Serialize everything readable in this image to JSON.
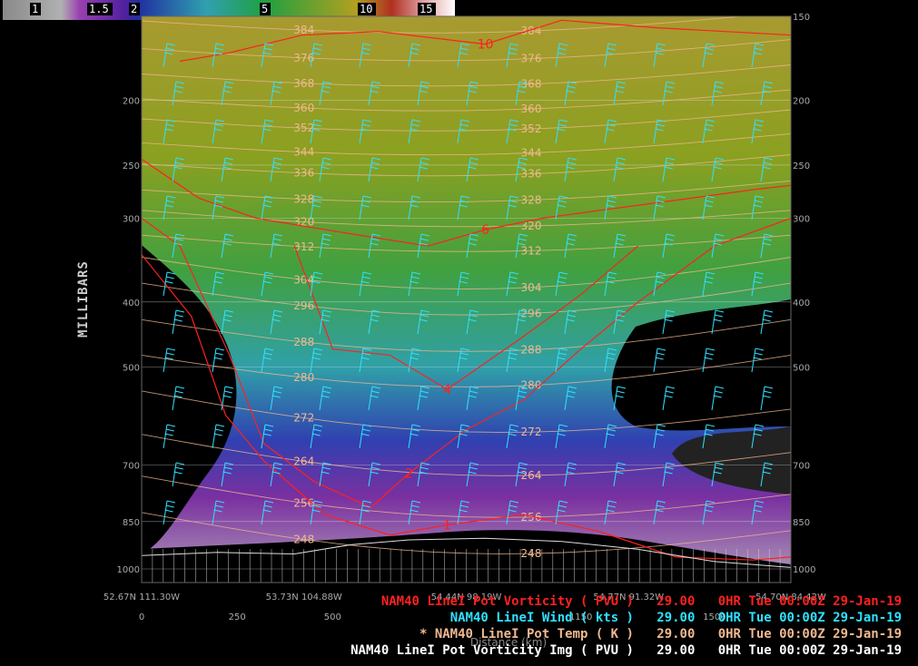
{
  "colorbar": {
    "ticks": [
      "1",
      "1.5",
      "2",
      "5",
      "10",
      "15"
    ]
  },
  "chart_data": {
    "type": "heatmap",
    "ylabel": "MILLIBARS",
    "xlabel": "Distance (km)",
    "yaxis": {
      "scale": "log",
      "ylim": [
        1000,
        150
      ],
      "left_ticks": [
        200,
        250,
        300,
        400,
        500,
        700,
        850,
        1000
      ],
      "right_ticks": [
        150,
        200,
        250,
        300,
        400,
        500,
        700,
        850,
        1000
      ]
    },
    "xaxis": {
      "xlim": [
        0,
        1700
      ],
      "distance_ticks": [
        0,
        250,
        500,
        1150,
        1500
      ],
      "location_labels": [
        {
          "d": 0,
          "text": "52.67N 111.30W"
        },
        {
          "d": 425,
          "text": "53.73N 104.88W"
        },
        {
          "d": 850,
          "text": "54.44N 98.19W"
        },
        {
          "d": 1275,
          "text": "54.77N 91.32W"
        },
        {
          "d": 1700,
          "text": "54.70N 84.42W"
        }
      ]
    },
    "pv_contours": [
      {
        "level": "10",
        "points": [
          [
            100,
            175
          ],
          [
            230,
            170
          ],
          [
            420,
            160
          ],
          [
            620,
            158
          ],
          [
            900,
            165
          ],
          [
            1100,
            152
          ],
          [
            1350,
            156
          ],
          [
            1700,
            160
          ]
        ]
      },
      {
        "level": "6",
        "points": [
          [
            0,
            245
          ],
          [
            150,
            280
          ],
          [
            300,
            300
          ],
          [
            450,
            310
          ],
          [
            600,
            320
          ],
          [
            750,
            330
          ],
          [
            900,
            312
          ],
          [
            1050,
            300
          ],
          [
            1200,
            292
          ],
          [
            1400,
            282
          ],
          [
            1600,
            272
          ],
          [
            1700,
            268
          ]
        ]
      },
      {
        "level": "4",
        "points": [
          [
            400,
            330
          ],
          [
            500,
            470
          ],
          [
            650,
            480
          ],
          [
            800,
            540
          ],
          [
            1000,
            450
          ],
          [
            1150,
            390
          ],
          [
            1300,
            330
          ]
        ]
      },
      {
        "level": "2",
        "points": [
          [
            0,
            300
          ],
          [
            100,
            330
          ],
          [
            230,
            480
          ],
          [
            320,
            650
          ],
          [
            450,
            740
          ],
          [
            600,
            810
          ],
          [
            700,
            720
          ],
          [
            850,
            620
          ],
          [
            1000,
            560
          ],
          [
            1150,
            470
          ],
          [
            1300,
            400
          ],
          [
            1500,
            330
          ],
          [
            1700,
            300
          ]
        ]
      },
      {
        "level": "1",
        "points": [
          [
            0,
            340
          ],
          [
            130,
            420
          ],
          [
            220,
            590
          ],
          [
            320,
            690
          ],
          [
            480,
            830
          ],
          [
            650,
            890
          ],
          [
            800,
            860
          ],
          [
            1000,
            830
          ],
          [
            1200,
            880
          ],
          [
            1400,
            960
          ],
          [
            1600,
            970
          ],
          [
            1700,
            960
          ]
        ]
      }
    ],
    "theta_contours": [
      {
        "label": "384",
        "p": 150
      },
      {
        "label": "376",
        "p": 165
      },
      {
        "label": "368",
        "p": 180
      },
      {
        "label": "360",
        "p": 196
      },
      {
        "label": "352",
        "p": 210
      },
      {
        "label": "344",
        "p": 228
      },
      {
        "label": "336",
        "p": 245
      },
      {
        "label": "328",
        "p": 268
      },
      {
        "label": "320",
        "p": 292
      },
      {
        "label": "312",
        "p": 318
      },
      {
        "label": "304",
        "p": 343
      },
      {
        "label": "296",
        "p": 375
      },
      {
        "label": "288",
        "p": 425
      },
      {
        "label": "280",
        "p": 480
      },
      {
        "label": "272",
        "p": 560
      },
      {
        "label": "264",
        "p": 650
      },
      {
        "label": "256",
        "p": 750
      },
      {
        "label": "248",
        "p": 850
      }
    ],
    "surface_pressure": [
      [
        0,
        955
      ],
      [
        200,
        945
      ],
      [
        400,
        950
      ],
      [
        550,
        920
      ],
      [
        700,
        905
      ],
      [
        900,
        900
      ],
      [
        1100,
        910
      ],
      [
        1300,
        935
      ],
      [
        1500,
        975
      ],
      [
        1700,
        995
      ]
    ]
  },
  "legend": [
    {
      "name": "NAM40 LineI Pot Vorticity ( PVU )",
      "value": "29.00",
      "time": "0HR Tue 00:00Z 29-Jan-19",
      "color": "#ff2020"
    },
    {
      "name": "NAM40 LineI Wind ( kts )",
      "value": "29.00",
      "time": "0HR Tue 00:00Z 29-Jan-19",
      "color": "#30e0ff"
    },
    {
      "name": "* NAM40 LineI Pot Temp ( K )",
      "value": "29.00",
      "time": "0HR Tue 00:00Z 29-Jan-19",
      "color": "#f0b890"
    },
    {
      "name": "NAM40 LineI Pot Vorticity Img ( PVU )",
      "value": "29.00",
      "time": "0HR Tue 00:00Z 29-Jan-19",
      "color": "#ffffff"
    }
  ],
  "colors": {
    "pv_contour": "#ff2020",
    "wind": "#30e0ff",
    "theta": "#f0b890"
  }
}
